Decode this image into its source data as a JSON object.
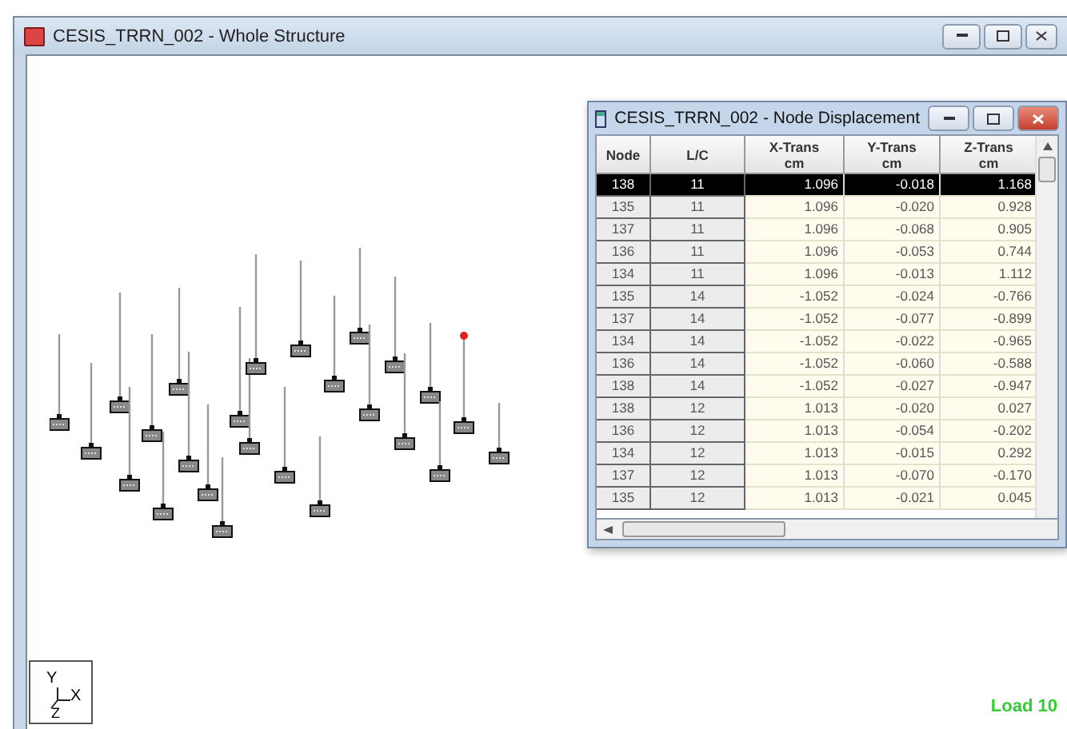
{
  "window": {
    "title": "CESIS_TRRN_002 - Whole Structure"
  },
  "status": {
    "load_label": "Load 10"
  },
  "axis": {
    "y": "Y",
    "x": "X",
    "z": "Z"
  },
  "table_window": {
    "title": "CESIS_TRRN_002 - Node Displacement",
    "columns": [
      {
        "label": "Node"
      },
      {
        "label": "L/C"
      },
      {
        "label": "X-Trans",
        "unit": "cm"
      },
      {
        "label": "Y-Trans",
        "unit": "cm"
      },
      {
        "label": "Z-Trans",
        "unit": "cm"
      }
    ],
    "rows": [
      {
        "selected": true,
        "cells": [
          "138",
          "11",
          "1.096",
          "-0.018",
          "1.168"
        ]
      },
      {
        "selected": false,
        "cells": [
          "135",
          "11",
          "1.096",
          "-0.020",
          "0.928"
        ]
      },
      {
        "selected": false,
        "cells": [
          "137",
          "11",
          "1.096",
          "-0.068",
          "0.905"
        ]
      },
      {
        "selected": false,
        "cells": [
          "136",
          "11",
          "1.096",
          "-0.053",
          "0.744"
        ]
      },
      {
        "selected": false,
        "cells": [
          "134",
          "11",
          "1.096",
          "-0.013",
          "1.112"
        ]
      },
      {
        "selected": false,
        "cells": [
          "135",
          "14",
          "-1.052",
          "-0.024",
          "-0.766"
        ]
      },
      {
        "selected": false,
        "cells": [
          "137",
          "14",
          "-1.052",
          "-0.077",
          "-0.899"
        ]
      },
      {
        "selected": false,
        "cells": [
          "134",
          "14",
          "-1.052",
          "-0.022",
          "-0.965"
        ]
      },
      {
        "selected": false,
        "cells": [
          "136",
          "14",
          "-1.052",
          "-0.060",
          "-0.588"
        ]
      },
      {
        "selected": false,
        "cells": [
          "138",
          "14",
          "-1.052",
          "-0.027",
          "-0.947"
        ]
      },
      {
        "selected": false,
        "cells": [
          "138",
          "12",
          "1.013",
          "-0.020",
          "0.027"
        ]
      },
      {
        "selected": false,
        "cells": [
          "136",
          "12",
          "1.013",
          "-0.054",
          "-0.202"
        ]
      },
      {
        "selected": false,
        "cells": [
          "134",
          "12",
          "1.013",
          "-0.015",
          "0.292"
        ]
      },
      {
        "selected": false,
        "cells": [
          "137",
          "12",
          "1.013",
          "-0.070",
          "-0.170"
        ]
      },
      {
        "selected": false,
        "cells": [
          "135",
          "12",
          "1.013",
          "-0.021",
          "0.045"
        ]
      }
    ]
  }
}
